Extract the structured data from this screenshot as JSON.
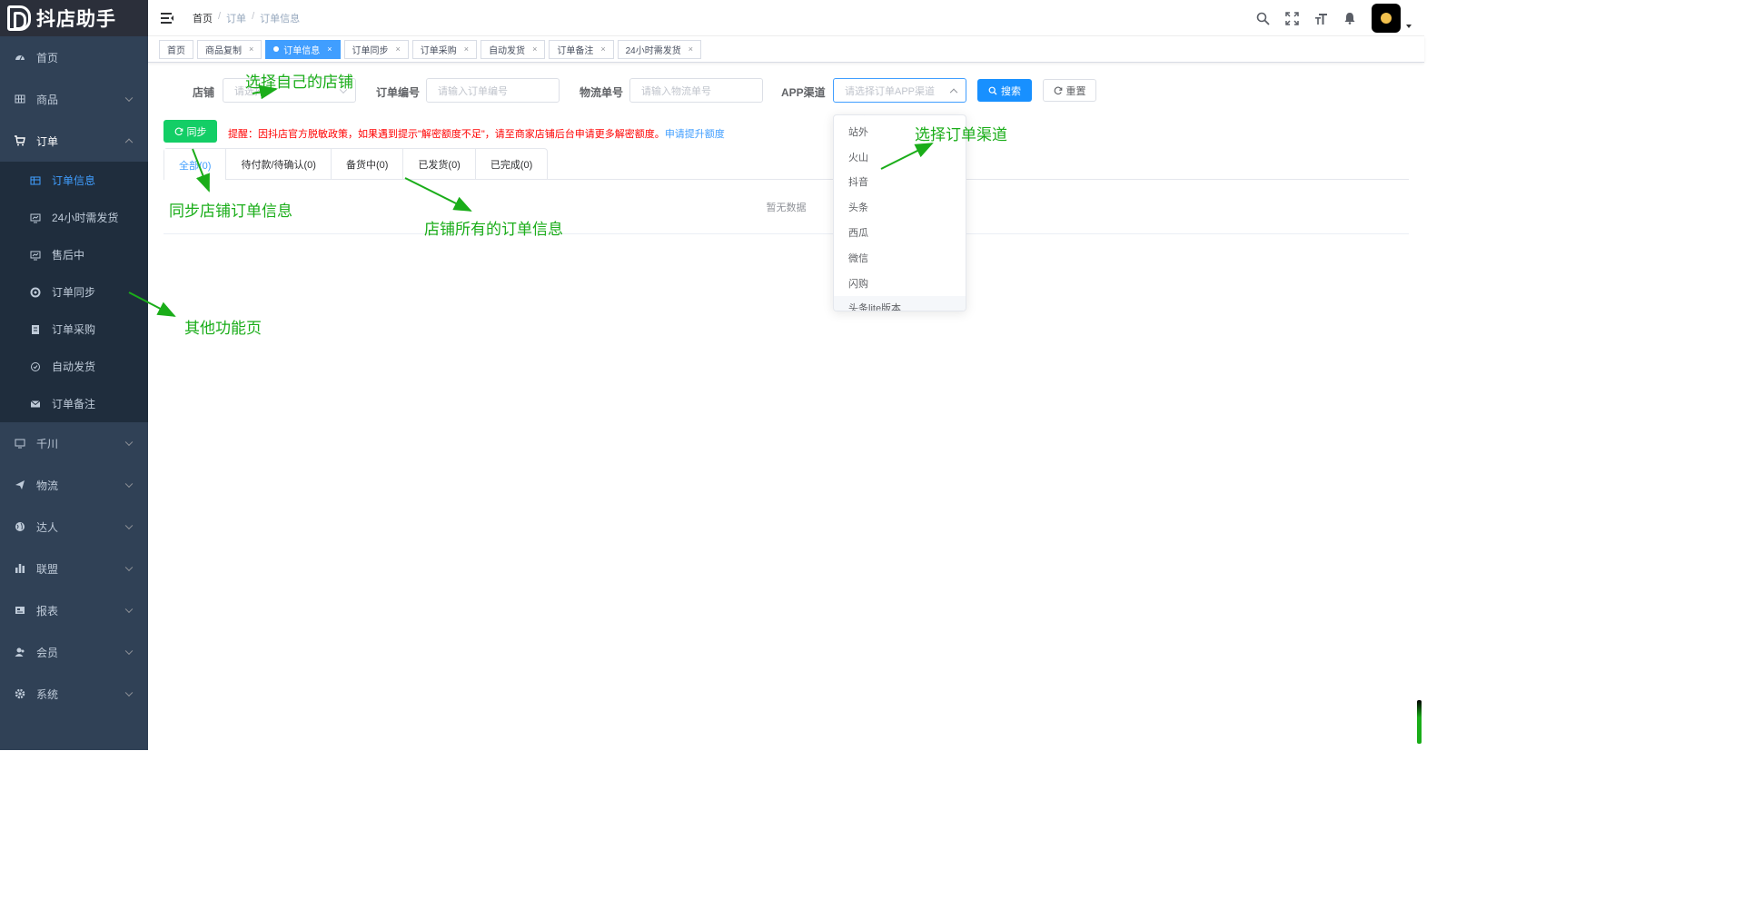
{
  "app": {
    "logo_text": "抖店助手"
  },
  "sidebar": {
    "items": [
      {
        "label": "首页",
        "icon": "dashboard-icon"
      },
      {
        "label": "商品",
        "icon": "grid-icon"
      },
      {
        "label": "订单",
        "icon": "cart-icon"
      },
      {
        "label": "千川",
        "icon": "monitor-icon"
      },
      {
        "label": "物流",
        "icon": "send-icon"
      },
      {
        "label": "达人",
        "icon": "globe-icon"
      },
      {
        "label": "联盟",
        "icon": "bar-chart-icon"
      },
      {
        "label": "报表",
        "icon": "report-icon"
      },
      {
        "label": "会员",
        "icon": "user-icon"
      },
      {
        "label": "系统",
        "icon": "gear-icon"
      }
    ],
    "order_sub": [
      {
        "label": "订单信息",
        "icon": "table-icon"
      },
      {
        "label": "24小时需发货",
        "icon": "monitor-icon"
      },
      {
        "label": "售后中",
        "icon": "monitor-icon"
      },
      {
        "label": "订单同步",
        "icon": "sync-icon"
      },
      {
        "label": "订单采购",
        "icon": "purchase-icon"
      },
      {
        "label": "自动发货",
        "icon": "clock-icon"
      },
      {
        "label": "订单备注",
        "icon": "mail-icon"
      }
    ]
  },
  "breadcrumb": {
    "home": "首页",
    "level1": "订单",
    "current": "订单信息",
    "separator": "/"
  },
  "tags": [
    {
      "label": "首页"
    },
    {
      "label": "商品复制"
    },
    {
      "label": "订单信息"
    },
    {
      "label": "订单同步"
    },
    {
      "label": "订单采购"
    },
    {
      "label": "自动发货"
    },
    {
      "label": "订单备注"
    },
    {
      "label": "24小时需发货"
    }
  ],
  "tag_close": "×",
  "form": {
    "shop_label": "店铺",
    "shop_placeholder": "请选择",
    "order_no_label": "订单编号",
    "order_no_placeholder": "请输入订单编号",
    "logistics_label": "物流单号",
    "logistics_placeholder": "请输入物流单号",
    "channel_label": "APP渠道",
    "channel_placeholder": "请选择订单APP渠道",
    "search_btn": "搜索",
    "reset_btn": "重置"
  },
  "sync_btn": "同步",
  "notice": {
    "text": "提醒：因抖店官方脱敏政策，如果遇到提示\"解密额度不足\"，请至商家店铺后台申请更多解密额度。",
    "link": "申请提升额度"
  },
  "tabs": [
    {
      "label": "全部(0)"
    },
    {
      "label": "待付款/待确认(0)"
    },
    {
      "label": "备货中(0)"
    },
    {
      "label": "已发货(0)"
    },
    {
      "label": "已完成(0)"
    }
  ],
  "table": {
    "empty_text": "暂无数据"
  },
  "channel_options": [
    "站外",
    "火山",
    "抖音",
    "头条",
    "西瓜",
    "微信",
    "闪购",
    "头条lite版本"
  ],
  "annotations": {
    "select_shop": "选择自己的店铺",
    "select_channel": "选择订单渠道",
    "sync_info": "同步店铺订单信息",
    "all_orders": "店铺所有的订单信息",
    "other_pages": "其他功能页"
  },
  "colors": {
    "sidebar_bg": "#304156",
    "primary": "#1890ff",
    "success": "#13ce66",
    "annotation": "#1aad19",
    "warning_text": "#ff0000"
  }
}
